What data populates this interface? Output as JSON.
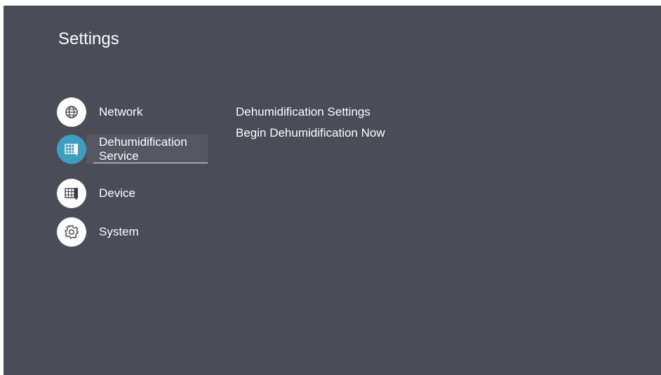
{
  "page": {
    "title": "Settings"
  },
  "menu": {
    "items": [
      {
        "label": "Network",
        "icon": "globe-icon"
      },
      {
        "label": "Dehumidification Service",
        "icon": "dehumidifier-icon",
        "selected": true
      },
      {
        "label": "Device",
        "icon": "display-device-icon"
      },
      {
        "label": "System",
        "icon": "gear-icon"
      }
    ]
  },
  "detail": {
    "items": [
      {
        "label": "Dehumidification Settings"
      },
      {
        "label": "Begin Dehumidification Now"
      }
    ]
  },
  "colors": {
    "background": "#4a4c57",
    "accent": "#3d9fbf",
    "text": "#ffffff"
  }
}
